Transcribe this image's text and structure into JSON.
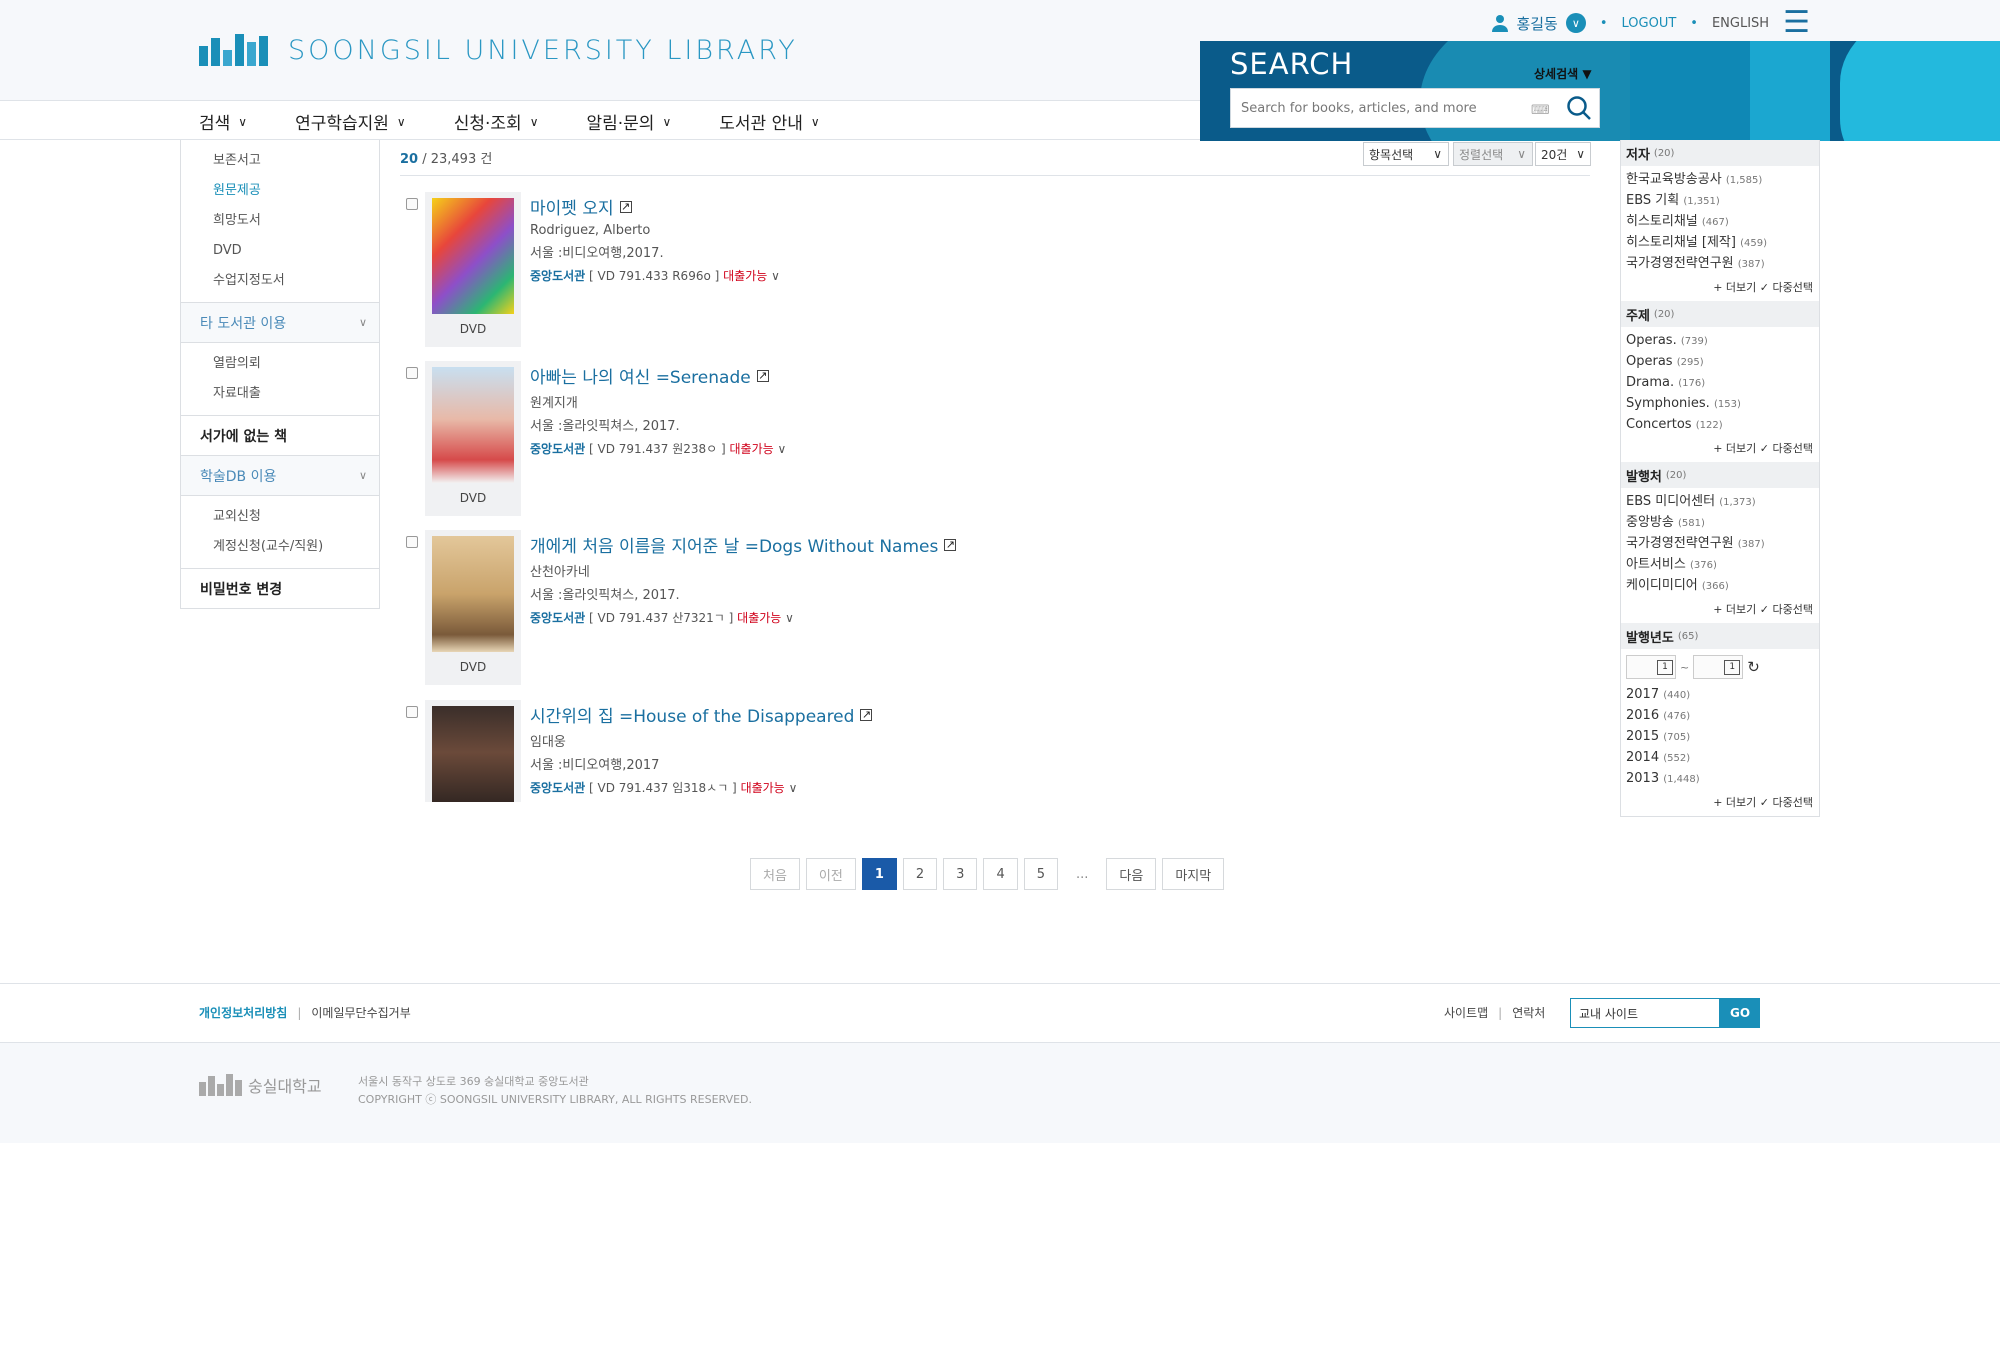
{
  "header": {
    "logo_text": "SOONGSIL UNIVERSITY LIBRARY",
    "user_name": "홍길동",
    "logout": "LOGOUT",
    "english": "ENGLISH",
    "brand_color": "#1a8fb8"
  },
  "nav": {
    "items": [
      "검색",
      "연구학습지원",
      "신청·조회",
      "알림·문의",
      "도서관 안내"
    ]
  },
  "search": {
    "title": "SEARCH",
    "advanced": "상세검색 ▼",
    "placeholder": "Search for books, articles, and more"
  },
  "sidebar": {
    "top_subs": [
      "보존서고",
      "원문제공",
      "희망도서",
      "DVD",
      "수업지정도서"
    ],
    "group1": "타 도서관 이용",
    "group1_subs": [
      "열람의뢰",
      "자료대출"
    ],
    "plain1": "서가에 없는 책",
    "group2": "학술DB 이용",
    "group2_subs": [
      "교외신청",
      "계정신청(교수/직원)"
    ],
    "plain2": "비밀번호 변경"
  },
  "results": {
    "count_page": "20",
    "count_total": " / 23,493 건",
    "select_field": "항목선택",
    "select_sort": "정렬선택",
    "select_per_page": "20건",
    "items": [
      {
        "title": "마이펫 오지",
        "author": "Rodriguez, Alberto",
        "pub": "서울 :비디오여행,2017.",
        "lib": "중앙도서관",
        "call": " [ VD 791.433 R696o ] ",
        "avail": "대출가능",
        "format": "DVD"
      },
      {
        "title": "아빠는 나의 여신 =Serenade",
        "author": "원계지개",
        "pub": "서울 :올라잇픽쳐스, 2017.",
        "lib": "중앙도서관",
        "call": " [ VD 791.437 원238ㅇ ] ",
        "avail": "대출가능",
        "format": "DVD"
      },
      {
        "title": "개에게 처음 이름을 지어준 날 =Dogs Without Names",
        "author": "산천아카네",
        "pub": "서울 :올라잇픽쳐스, 2017.",
        "lib": "중앙도서관",
        "call": " [ VD 791.437 산7321ㄱ ] ",
        "avail": "대출가능",
        "format": "DVD"
      },
      {
        "title": "시간위의 집 =House of the Disappeared",
        "author": "임대웅",
        "pub": "서울 :비디오여행,2017",
        "lib": "중앙도서관",
        "call": " [ VD 791.437 임318ㅅㄱ ] ",
        "avail": "대출가능",
        "format": ""
      }
    ]
  },
  "pager": {
    "first": "처음",
    "prev": "이전",
    "pages": [
      "1",
      "2",
      "3",
      "4",
      "5"
    ],
    "dots": "...",
    "next": "다음",
    "last": "마지막"
  },
  "facets": {
    "more": "+ 더보기",
    "multi": "✓ 다중선택",
    "author": {
      "title": "저자",
      "count": "(20)",
      "items": [
        [
          "한국교육방송공사",
          "(1,585)"
        ],
        [
          "EBS 기획",
          "(1,351)"
        ],
        [
          "히스토리채널",
          "(467)"
        ],
        [
          "히스토리채널 [제작]",
          "(459)"
        ],
        [
          "국가경영전략연구원",
          "(387)"
        ]
      ]
    },
    "subject": {
      "title": "주제",
      "count": "(20)",
      "items": [
        [
          "Operas.",
          "(739)"
        ],
        [
          "Operas",
          "(295)"
        ],
        [
          "Drama.",
          "(176)"
        ],
        [
          "Symphonies.",
          "(153)"
        ],
        [
          "Concertos",
          "(122)"
        ]
      ]
    },
    "publisher": {
      "title": "발행처",
      "count": "(20)",
      "items": [
        [
          "EBS 미디어센터",
          "(1,373)"
        ],
        [
          "중앙방송",
          "(581)"
        ],
        [
          "국가경영전략연구원",
          "(387)"
        ],
        [
          "아트서비스",
          "(376)"
        ],
        [
          "케이디미디어",
          "(366)"
        ]
      ]
    },
    "year": {
      "title": "발행년도",
      "count": "(65)",
      "range_sep": "~",
      "items": [
        [
          "2017",
          "(440)"
        ],
        [
          "2016",
          "(476)"
        ],
        [
          "2015",
          "(705)"
        ],
        [
          "2014",
          "(552)"
        ],
        [
          "2013",
          "(1,448)"
        ]
      ]
    }
  },
  "footer": {
    "privacy": "개인정보처리방침",
    "email_refuse": "이메일무단수집거부",
    "sitemap": "사이트맵",
    "contact": "연락처",
    "site_select": "교내 사이트",
    "go": "GO",
    "uni_name": "숭실대학교",
    "address": "서울시 동작구 상도로 369 숭실대학교 중앙도서관",
    "copyright": "COPYRIGHT ⓒ SOONGSIL UNIVERSITY LIBRARY, ALL RIGHTS RESERVED."
  }
}
